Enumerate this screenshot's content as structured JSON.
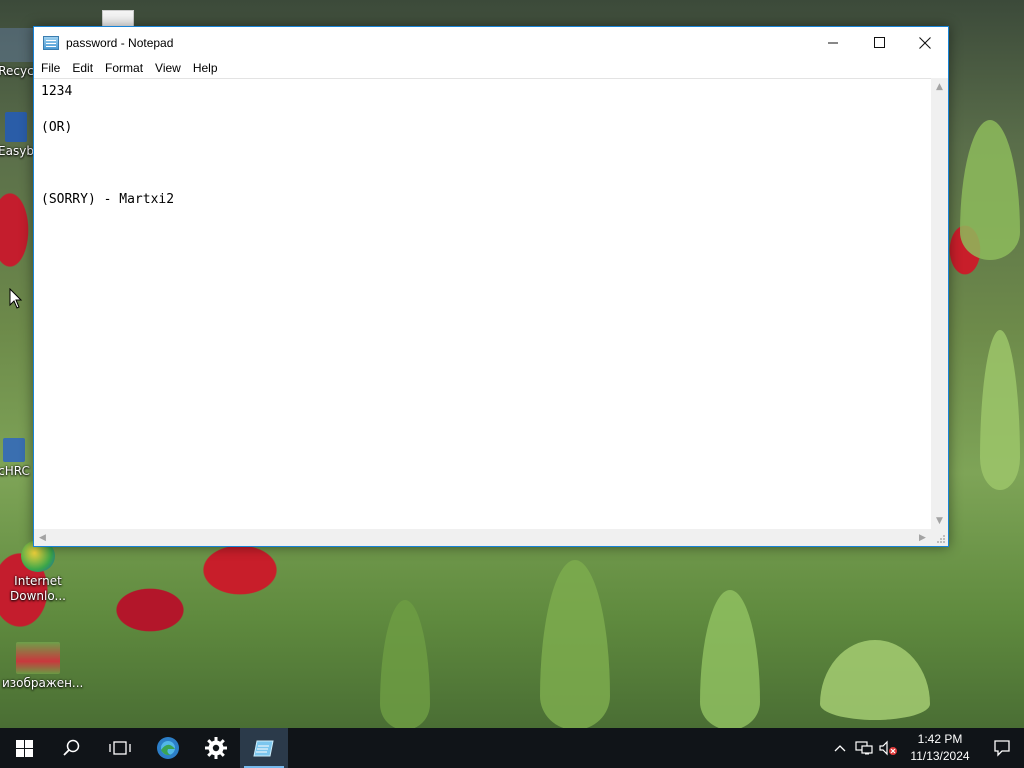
{
  "desktop": {
    "icons": [
      {
        "label": "Recyc"
      },
      {
        "label": "Easyb"
      },
      {
        "label": "cHRC"
      },
      {
        "label": "Internet Downlo..."
      },
      {
        "label": "изображен..."
      }
    ]
  },
  "notepad": {
    "title": "password - Notepad",
    "menu": [
      "File",
      "Edit",
      "Format",
      "View",
      "Help"
    ],
    "content": "1234\n\n(OR)\n\n\n\n(SORRY) - Martxi2"
  },
  "taskbar": {
    "items": [
      "start-icon",
      "search-icon",
      "task-view-icon",
      "edge-icon",
      "settings-icon",
      "notepad-icon"
    ],
    "clock": {
      "time": "1:42 PM",
      "date": "11/13/2024"
    }
  },
  "colors": {
    "accent": "#1883d7",
    "taskbar": "#101418"
  }
}
